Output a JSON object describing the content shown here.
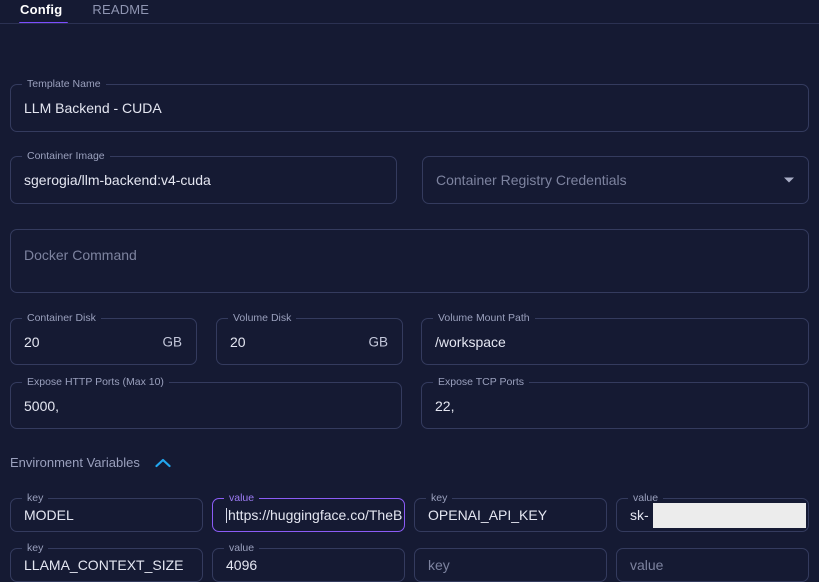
{
  "colors": {
    "background": "#151a33",
    "accent_purple": "#7c4dff",
    "focus_purple": "#8b5cf6",
    "chevron_cyan": "#22a7f0",
    "border": "#343b5e",
    "label": "#9aa0bd",
    "redaction": "#ececec"
  },
  "tabs": [
    {
      "label": "Config",
      "active": true
    },
    {
      "label": "README",
      "active": false
    }
  ],
  "form": {
    "template_name": {
      "label": "Template Name",
      "value": "LLM Backend - CUDA"
    },
    "container_image": {
      "label": "Container Image",
      "value": "sgerogia/llm-backend:v4-cuda"
    },
    "registry_credentials": {
      "placeholder": "Container Registry Credentials",
      "value": "",
      "icon": "chevron-down-icon"
    },
    "docker_command": {
      "placeholder": "Docker Command",
      "value": ""
    },
    "container_disk": {
      "label": "Container Disk",
      "value": "20",
      "suffix": "GB"
    },
    "volume_disk": {
      "label": "Volume Disk",
      "value": "20",
      "suffix": "GB"
    },
    "volume_mount_path": {
      "label": "Volume Mount Path",
      "value": "/workspace"
    },
    "http_ports": {
      "label": "Expose HTTP Ports (Max 10)",
      "value": "5000,"
    },
    "tcp_ports": {
      "label": "Expose TCP Ports",
      "value": "22,"
    }
  },
  "environment_variables": {
    "title": "Environment Variables",
    "collapse_icon": "chevron-up-icon",
    "key_label": "key",
    "value_label": "value",
    "key_placeholder": "key",
    "value_placeholder": "value",
    "rows": [
      {
        "key": {
          "label": "key",
          "value": "MODEL",
          "focused": false
        },
        "value": {
          "label": "value",
          "value": "https://huggingface.co/TheB",
          "focused": true,
          "caret": true
        },
        "key2": {
          "label": "key",
          "value": "OPENAI_API_KEY",
          "focused": false
        },
        "value2": {
          "label": "value",
          "value": "sk-",
          "focused": false,
          "redacted": true
        }
      },
      {
        "key": {
          "label": "key",
          "value": "LLAMA_CONTEXT_SIZE",
          "focused": false
        },
        "value": {
          "label": "value",
          "value": "4096",
          "focused": false
        },
        "key2": {
          "label": "",
          "value": "",
          "placeholder": "key",
          "focused": false
        },
        "value2": {
          "label": "",
          "value": "",
          "placeholder": "value",
          "focused": false
        }
      }
    ]
  }
}
